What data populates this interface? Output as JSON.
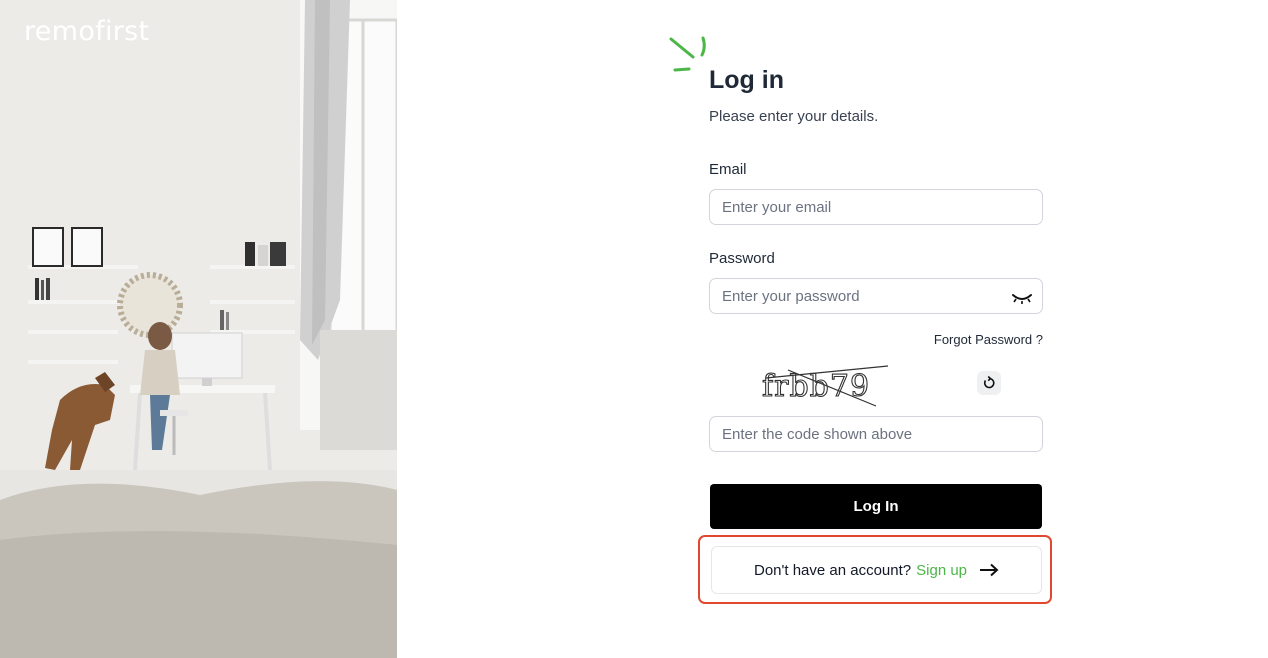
{
  "brand": {
    "logo_text": "remofirst"
  },
  "login": {
    "title": "Log in",
    "subtitle": "Please enter your details.",
    "email": {
      "label": "Email",
      "placeholder": "Enter your email",
      "value": ""
    },
    "password": {
      "label": "Password",
      "placeholder": "Enter your password",
      "value": "",
      "toggle_icon": "eye-closed-icon"
    },
    "forgot_label": "Forgot Password ?",
    "captcha": {
      "text": "frbb79",
      "refresh_icon": "refresh-icon"
    },
    "code": {
      "placeholder": "Enter the code shown above",
      "value": ""
    },
    "submit_label": "Log In",
    "signup": {
      "prompt": "Don't have an account?",
      "link_label": "Sign up",
      "arrow_icon": "arrow-right-icon"
    }
  },
  "colors": {
    "accent_green": "#4cb648",
    "button_black": "#000000",
    "highlight_red": "#e0492f"
  }
}
